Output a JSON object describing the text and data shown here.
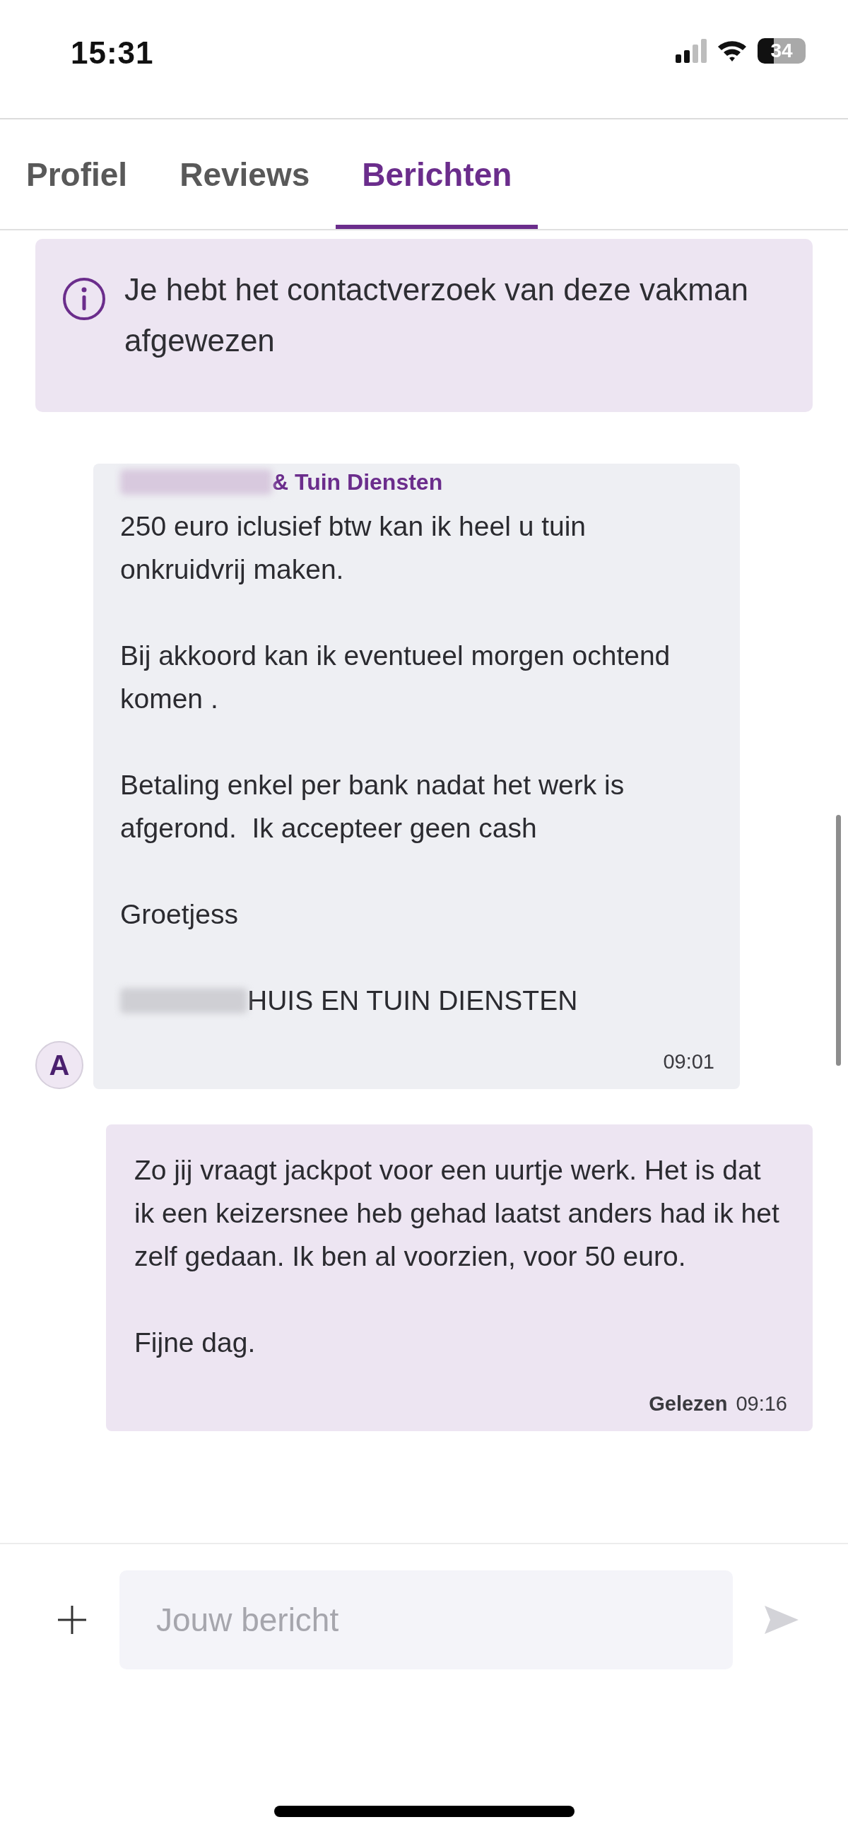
{
  "status_bar": {
    "time": "15:31",
    "battery": "34"
  },
  "tabs": [
    {
      "label": "Profiel",
      "selected": false
    },
    {
      "label": "Reviews",
      "selected": false
    },
    {
      "label": "Berichten",
      "selected": true
    }
  ],
  "notice": {
    "text": "Je hebt het contactverzoek van deze vakman afgewezen"
  },
  "messages": [
    {
      "kind": "incoming",
      "sender": {
        "name": "& Tuin Diensten",
        "redacted": true
      },
      "avatar": "A",
      "paragraphs": [
        {
          "text": "250 euro iclusief btw kan ik heel u tuin onkruidvrij maken.",
          "redacted": false
        },
        {
          "text": "Bij akkoord kan ik eventueel morgen ochtend komen .",
          "redacted": false
        },
        {
          "text": "Betaling enkel per bank nadat het werk is afgerond.  Ik accepteer geen cash",
          "redacted": false
        },
        {
          "text": "Groetjess",
          "redacted": false
        },
        {
          "text": "HUIS EN TUIN DIENSTEN",
          "redacted": true
        }
      ],
      "time": "09:01"
    },
    {
      "kind": "outgoing",
      "paragraphs": [
        {
          "text": "Zo jij vraagt jackpot voor een uurtje werk. Het is dat ik een keizersnee heb gehad laatst anders had ik het zelf gedaan. Ik ben al voorzien, voor 50 euro.",
          "redacted": false
        },
        {
          "text": "Fijne dag.",
          "redacted": false
        }
      ],
      "status": "Gelezen",
      "time": "09:16"
    }
  ],
  "composer": {
    "placeholder": "Jouw bericht"
  }
}
